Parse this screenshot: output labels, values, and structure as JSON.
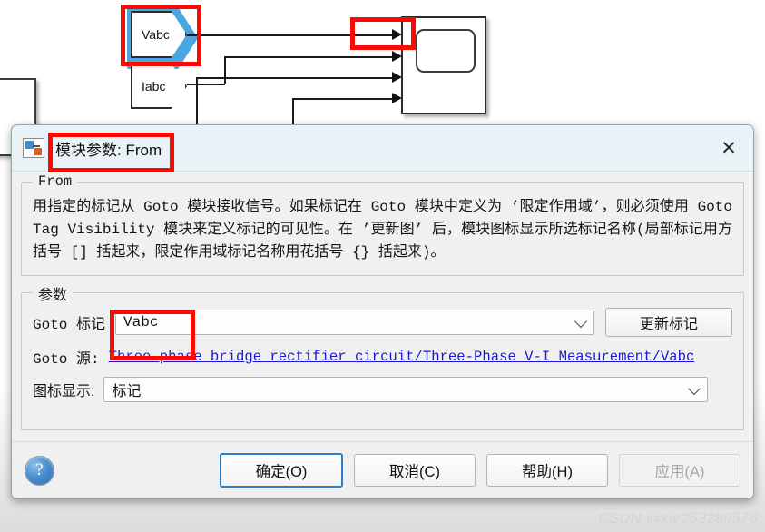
{
  "canvas": {
    "blocks": [
      {
        "name": "from-block-vabc",
        "label": "Vabc",
        "selected": true
      },
      {
        "name": "from-block-iabc",
        "label": "Iabc",
        "selected": false
      },
      {
        "name": "scope-block",
        "label": "",
        "selected": false
      },
      {
        "name": "partial-block-left",
        "label": "",
        "selected": false
      }
    ],
    "annotations": [
      {
        "name": "redbox-vabc-block"
      },
      {
        "name": "redbox-scope-input-port"
      }
    ]
  },
  "dialog": {
    "title": "模块参数: From",
    "title_icon": "simulink-block-icon",
    "close_icon": "close-icon",
    "description": {
      "legend": "From",
      "text": "用指定的标记从 Goto 模块接收信号。如果标记在 Goto 模块中定义为 ’限定作用域’，则必须使用 Goto Tag Visibility 模块来定义标记的可见性。在 ’更新图’ 后，模块图标显示所选标记名称(局部标记用方括号 [] 括起来，限定作用域标记名称用花括号 {} 括起来)。"
    },
    "parameters": {
      "legend": "参数",
      "goto_tag": {
        "label": "Goto 标记",
        "value": "Vabc",
        "chevron_icon": "chevron-down-icon"
      },
      "update_tag_button": "更新标记",
      "goto_source": {
        "label": "Goto 源:",
        "link": "Three phase bridge rectifier circuit/Three-Phase V-I Measurement/Vabc"
      },
      "icon_display": {
        "label": "图标显示:",
        "value": "标记",
        "chevron_icon": "chevron-down-icon"
      }
    },
    "footer": {
      "help_icon": "help-icon",
      "ok": "确定(O)",
      "cancel": "取消(C)",
      "help": "帮助(H)",
      "apply": "应用(A)",
      "apply_disabled": true
    }
  },
  "watermark": "CSDN @xie253289576",
  "colors": {
    "accent": "#2a7fc9",
    "annotation_red": "#fb0a05",
    "link_blue": "#1a18d8",
    "titlebar": "#e9f2f6",
    "body_bg": "#f0f0f0",
    "selection_blue": "#4aa6e0"
  }
}
